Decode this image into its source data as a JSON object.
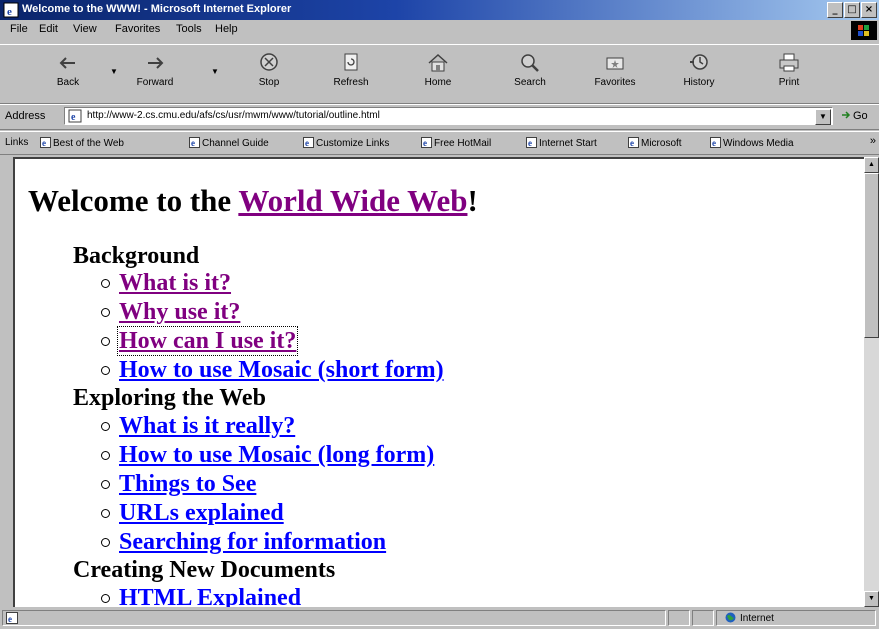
{
  "window": {
    "title": "Welcome to the WWW! - Microsoft Internet Explorer",
    "controls": [
      "_",
      "□",
      "×"
    ]
  },
  "menu": [
    {
      "label": "File"
    },
    {
      "label": "Edit"
    },
    {
      "label": "View"
    },
    {
      "label": "Favorites"
    },
    {
      "label": "Tools"
    },
    {
      "label": "Help"
    }
  ],
  "toolbar": {
    "back": "Back",
    "forward": "Forward",
    "stop": "Stop",
    "refresh": "Refresh",
    "home": "Home",
    "search": "Search",
    "favorites": "Favorites",
    "history": "History",
    "print": "Print"
  },
  "address": {
    "label": "Address",
    "url": "http://www-2.cs.cmu.edu/afs/cs/usr/mwm/www/tutorial/outline.html",
    "go": "Go"
  },
  "links": {
    "label": "Links",
    "items": [
      "Best of the Web",
      "Channel Guide",
      "Customize Links",
      "Free HotMail",
      "Internet Start",
      "Microsoft",
      "Windows Media"
    ]
  },
  "page": {
    "heading_prefix": "Welcome to the ",
    "heading_link": "World Wide Web",
    "heading_suffix": "!",
    "sections": [
      {
        "title": "Background",
        "items": [
          {
            "label": "What is it?",
            "state": "visited"
          },
          {
            "label": "Why use it?",
            "state": "visited"
          },
          {
            "label": "How can I use it?",
            "state": "visited-focused"
          },
          {
            "label": "How to use Mosaic (short form)",
            "state": "unvisited"
          }
        ]
      },
      {
        "title": "Exploring the Web",
        "items": [
          {
            "label": "What is it really?",
            "state": "unvisited"
          },
          {
            "label": "How to use Mosaic (long form)",
            "state": "unvisited"
          },
          {
            "label": "Things to See",
            "state": "unvisited"
          },
          {
            "label": "URLs explained",
            "state": "unvisited"
          },
          {
            "label": "Searching for information",
            "state": "unvisited"
          }
        ]
      },
      {
        "title": "Creating New Documents",
        "items": [
          {
            "label": "HTML Explained",
            "state": "unvisited"
          }
        ]
      }
    ]
  },
  "status": {
    "zone": "Internet"
  },
  "colors": {
    "visited_link": "#800080",
    "unvisited_link": "#0000ff",
    "chrome": "#c0c0c0",
    "titlebar": "#0a246a"
  }
}
